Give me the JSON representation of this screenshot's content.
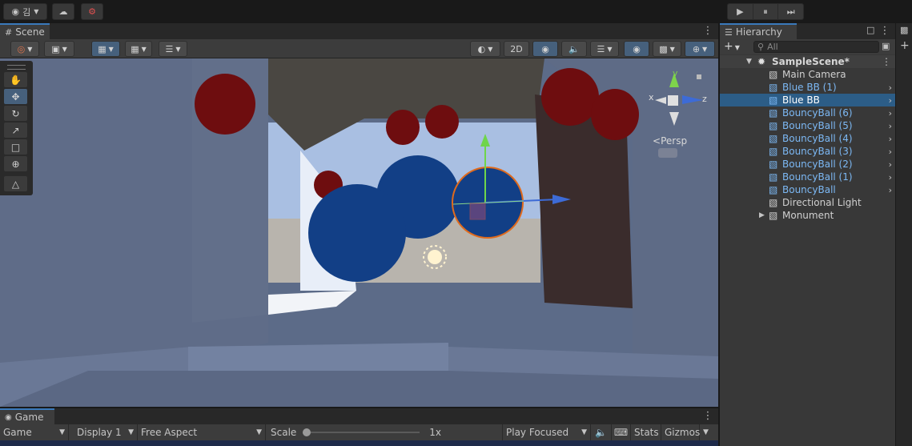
{
  "toolbar": {
    "account_label": "김",
    "play": "▶",
    "pause": "⏸",
    "step": "⏭"
  },
  "scene": {
    "tab_label": "Scene",
    "toggle_2d": "2D",
    "persp_label": "Persp",
    "gizmo_axes": {
      "x": "x",
      "y": "y",
      "z": "z"
    }
  },
  "game": {
    "tab_label": "Game",
    "view_select": "Game",
    "display_select": "Display 1",
    "aspect_select": "Free Aspect",
    "scale_label": "Scale",
    "scale_value": "1x",
    "scale_fraction": 0,
    "play_mode_select": "Play Focused",
    "stats_label": "Stats",
    "gizmos_label": "Gizmos"
  },
  "hierarchy": {
    "tab_label": "Hierarchy",
    "search_placeholder": "All",
    "scene_name": "SampleScene*",
    "items": [
      {
        "label": "Main Camera",
        "prefab": false,
        "selected": false,
        "expandable": false
      },
      {
        "label": "Blue BB (1)",
        "prefab": true,
        "selected": false,
        "expandable": true
      },
      {
        "label": "Blue BB",
        "prefab": true,
        "selected": true,
        "expandable": true
      },
      {
        "label": "BouncyBall (6)",
        "prefab": true,
        "selected": false,
        "expandable": true
      },
      {
        "label": "BouncyBall (5)",
        "prefab": true,
        "selected": false,
        "expandable": true
      },
      {
        "label": "BouncyBall (4)",
        "prefab": true,
        "selected": false,
        "expandable": true
      },
      {
        "label": "BouncyBall (3)",
        "prefab": true,
        "selected": false,
        "expandable": true
      },
      {
        "label": "BouncyBall (2)",
        "prefab": true,
        "selected": false,
        "expandable": true
      },
      {
        "label": "BouncyBall (1)",
        "prefab": true,
        "selected": false,
        "expandable": true
      },
      {
        "label": "BouncyBall",
        "prefab": true,
        "selected": false,
        "expandable": true
      },
      {
        "label": "Directional Light",
        "prefab": false,
        "selected": false,
        "expandable": false
      },
      {
        "label": "Monument",
        "prefab": false,
        "selected": false,
        "expandable": false,
        "foldout": true
      }
    ]
  },
  "colors": {
    "accent": "#3a79bb",
    "selection": "#2c5d87",
    "prefab_text": "#7cb8f4",
    "ball_blue": "#123f86",
    "ball_red": "#6e0d0f"
  }
}
